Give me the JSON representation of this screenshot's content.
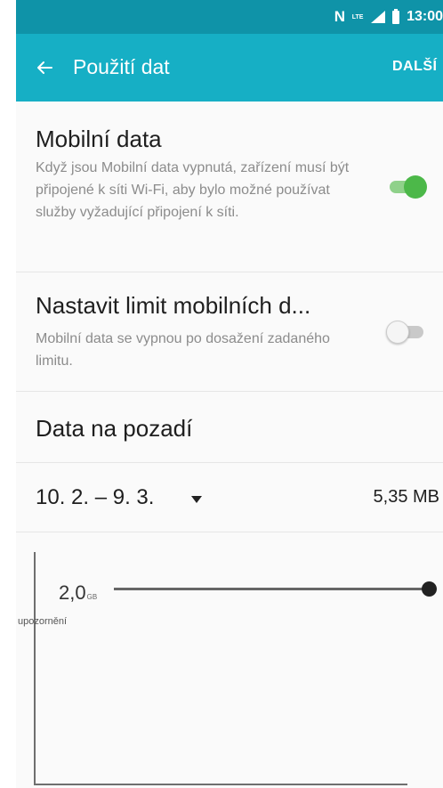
{
  "status_bar": {
    "nfc": "N",
    "network": "LTE",
    "time": "13:00"
  },
  "app_bar": {
    "title": "Použití dat",
    "more_label": "DALŠÍ"
  },
  "mobile_data": {
    "title": "Mobilní data",
    "description": "Když jsou Mobilní data vypnutá, zařízení musí být připojené k síti Wi-Fi, aby bylo možné používat služby vyžadující připojení k síti.",
    "enabled": true
  },
  "data_limit": {
    "title": "Nastavit limit mobilních d...",
    "description": "Mobilní data se vypnou po dosažení zadaného limitu.",
    "enabled": false
  },
  "background_data": {
    "title": "Data na pozadí"
  },
  "usage_cycle": {
    "range": "10. 2. – 9. 3.",
    "total": "5,35 MB"
  },
  "chart": {
    "warning_value": "2,0",
    "warning_unit": "GB",
    "warning_label": "upozornění"
  },
  "colors": {
    "status_bar": "#0f93a8",
    "app_bar": "#16afc5",
    "toggle_on": "#4cb849",
    "toggle_off": "#c9c9c9"
  },
  "icons": {
    "back": "arrow-left",
    "signal": "cell-signal",
    "battery": "battery",
    "dropdown": "triangle-down"
  }
}
